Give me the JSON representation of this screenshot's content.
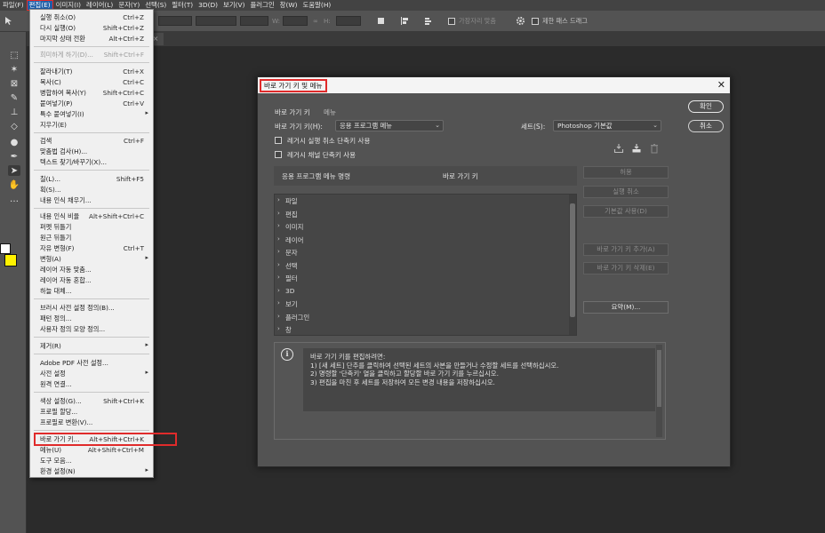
{
  "menubar": {
    "items": [
      "파일(F)",
      "편집(E)",
      "이미지(I)",
      "레이어(L)",
      "문자(Y)",
      "선택(S)",
      "필터(T)",
      "3D(D)",
      "보기(V)",
      "플러그인",
      "창(W)",
      "도움말(H)"
    ]
  },
  "options": {
    "antialias_label": "가장자리 맞춤",
    "constrain_label": "제한 패스 드래그",
    "zero_value": "0"
  },
  "edit_menu": {
    "items": [
      {
        "label": "실행 취소(O)",
        "shortcut": "Ctrl+Z"
      },
      {
        "label": "다시 실행(O)",
        "shortcut": "Shift+Ctrl+Z"
      },
      {
        "label": "마지막 상태 전환",
        "shortcut": "Alt+Ctrl+Z"
      },
      {
        "label": "희미하게 하기(D)...",
        "shortcut": "Shift+Ctrl+F"
      },
      {
        "label": "잘라내기(T)",
        "shortcut": "Ctrl+X"
      },
      {
        "label": "복사(C)",
        "shortcut": "Ctrl+C"
      },
      {
        "label": "병합하여 복사(Y)",
        "shortcut": "Shift+Ctrl+C"
      },
      {
        "label": "붙여넣기(P)",
        "shortcut": "Ctrl+V"
      },
      {
        "label": "특수 붙여넣기(I)",
        "shortcut": ""
      },
      {
        "label": "지우기(E)",
        "shortcut": ""
      },
      {
        "label": "검색",
        "shortcut": "Ctrl+F"
      },
      {
        "label": "맞춤법 검사(H)...",
        "shortcut": ""
      },
      {
        "label": "텍스트 찾기/바꾸기(X)...",
        "shortcut": ""
      },
      {
        "label": "칠(L)...",
        "shortcut": "Shift+F5"
      },
      {
        "label": "획(S)...",
        "shortcut": ""
      },
      {
        "label": "내용 인식 채우기...",
        "shortcut": ""
      },
      {
        "label": "내용 인식 비율",
        "shortcut": "Alt+Shift+Ctrl+C"
      },
      {
        "label": "퍼펫 뒤틀기",
        "shortcut": ""
      },
      {
        "label": "원근 뒤틀기",
        "shortcut": ""
      },
      {
        "label": "자유 변형(F)",
        "shortcut": "Ctrl+T"
      },
      {
        "label": "변형(A)",
        "shortcut": ""
      },
      {
        "label": "레이어 자동 맞춤...",
        "shortcut": ""
      },
      {
        "label": "레이어 자동 혼합...",
        "shortcut": ""
      },
      {
        "label": "하늘 대체...",
        "shortcut": ""
      },
      {
        "label": "브러시 사전 설정 정의(B)...",
        "shortcut": ""
      },
      {
        "label": "패턴 정의...",
        "shortcut": ""
      },
      {
        "label": "사용자 정의 모양 정의...",
        "shortcut": ""
      },
      {
        "label": "제거(R)",
        "shortcut": ""
      },
      {
        "label": "Adobe PDF 사전 설정...",
        "shortcut": ""
      },
      {
        "label": "사전 설정",
        "shortcut": ""
      },
      {
        "label": "원격 연결...",
        "shortcut": ""
      },
      {
        "label": "색상 설정(G)...",
        "shortcut": "Shift+Ctrl+K"
      },
      {
        "label": "프로필 할당...",
        "shortcut": ""
      },
      {
        "label": "프로필로 변환(V)...",
        "shortcut": ""
      },
      {
        "label": "바로 가기 키...",
        "shortcut": "Alt+Shift+Ctrl+K"
      },
      {
        "label": "메뉴(U)",
        "shortcut": "Alt+Shift+Ctrl+M"
      },
      {
        "label": "도구 모음...",
        "shortcut": ""
      },
      {
        "label": "환경 설정(N)",
        "shortcut": ""
      }
    ]
  },
  "dialog": {
    "title": "바로 가기 키 및 메뉴",
    "ok_label": "확인",
    "cancel_label": "취소",
    "tab_shortcuts": "바로 가기 키",
    "tab_menus": "메뉴",
    "shortcuts_for_label": "바로 가기 키(H):",
    "shortcuts_for_value": "응용 프로그램 메뉴",
    "set_label": "세트(S):",
    "set_value": "Photoshop 기본값",
    "legacy_undo_label": "레거시 실행 취소 단축키 사용",
    "legacy_channel_label": "레거시 채널 단축키 사용",
    "col_command": "응용 프로그램 메뉴 명령",
    "col_shortcut": "바로 가기 키",
    "menu_list": [
      "파일",
      "편집",
      "이미지",
      "레이어",
      "문자",
      "선택",
      "필터",
      "3D",
      "보기",
      "플러그인",
      "창"
    ],
    "btn_accept": "허용",
    "btn_undo": "실행 취소",
    "btn_default": "기본값 사용(D)",
    "btn_add": "바로 가기 키 추가(A)",
    "btn_delete": "바로 가기 키 삭제(E)",
    "btn_summarize": "요약(M)...",
    "info_icon": "i",
    "info_lines": [
      "바로 가기 키를 편집하려면:",
      "1) [새 세트] 단추를 클릭하여 선택된 세트의 사본을 만들거나 수정할 세트를 선택하십시오.",
      "2) 명령할 '단축키' 열을 클릭하고 할당할 바로 가기 키를 누르십시오.",
      "3) 편집을 마친 후 세트를 저장하여 모든 변경 내용을 저장하십시오."
    ]
  }
}
